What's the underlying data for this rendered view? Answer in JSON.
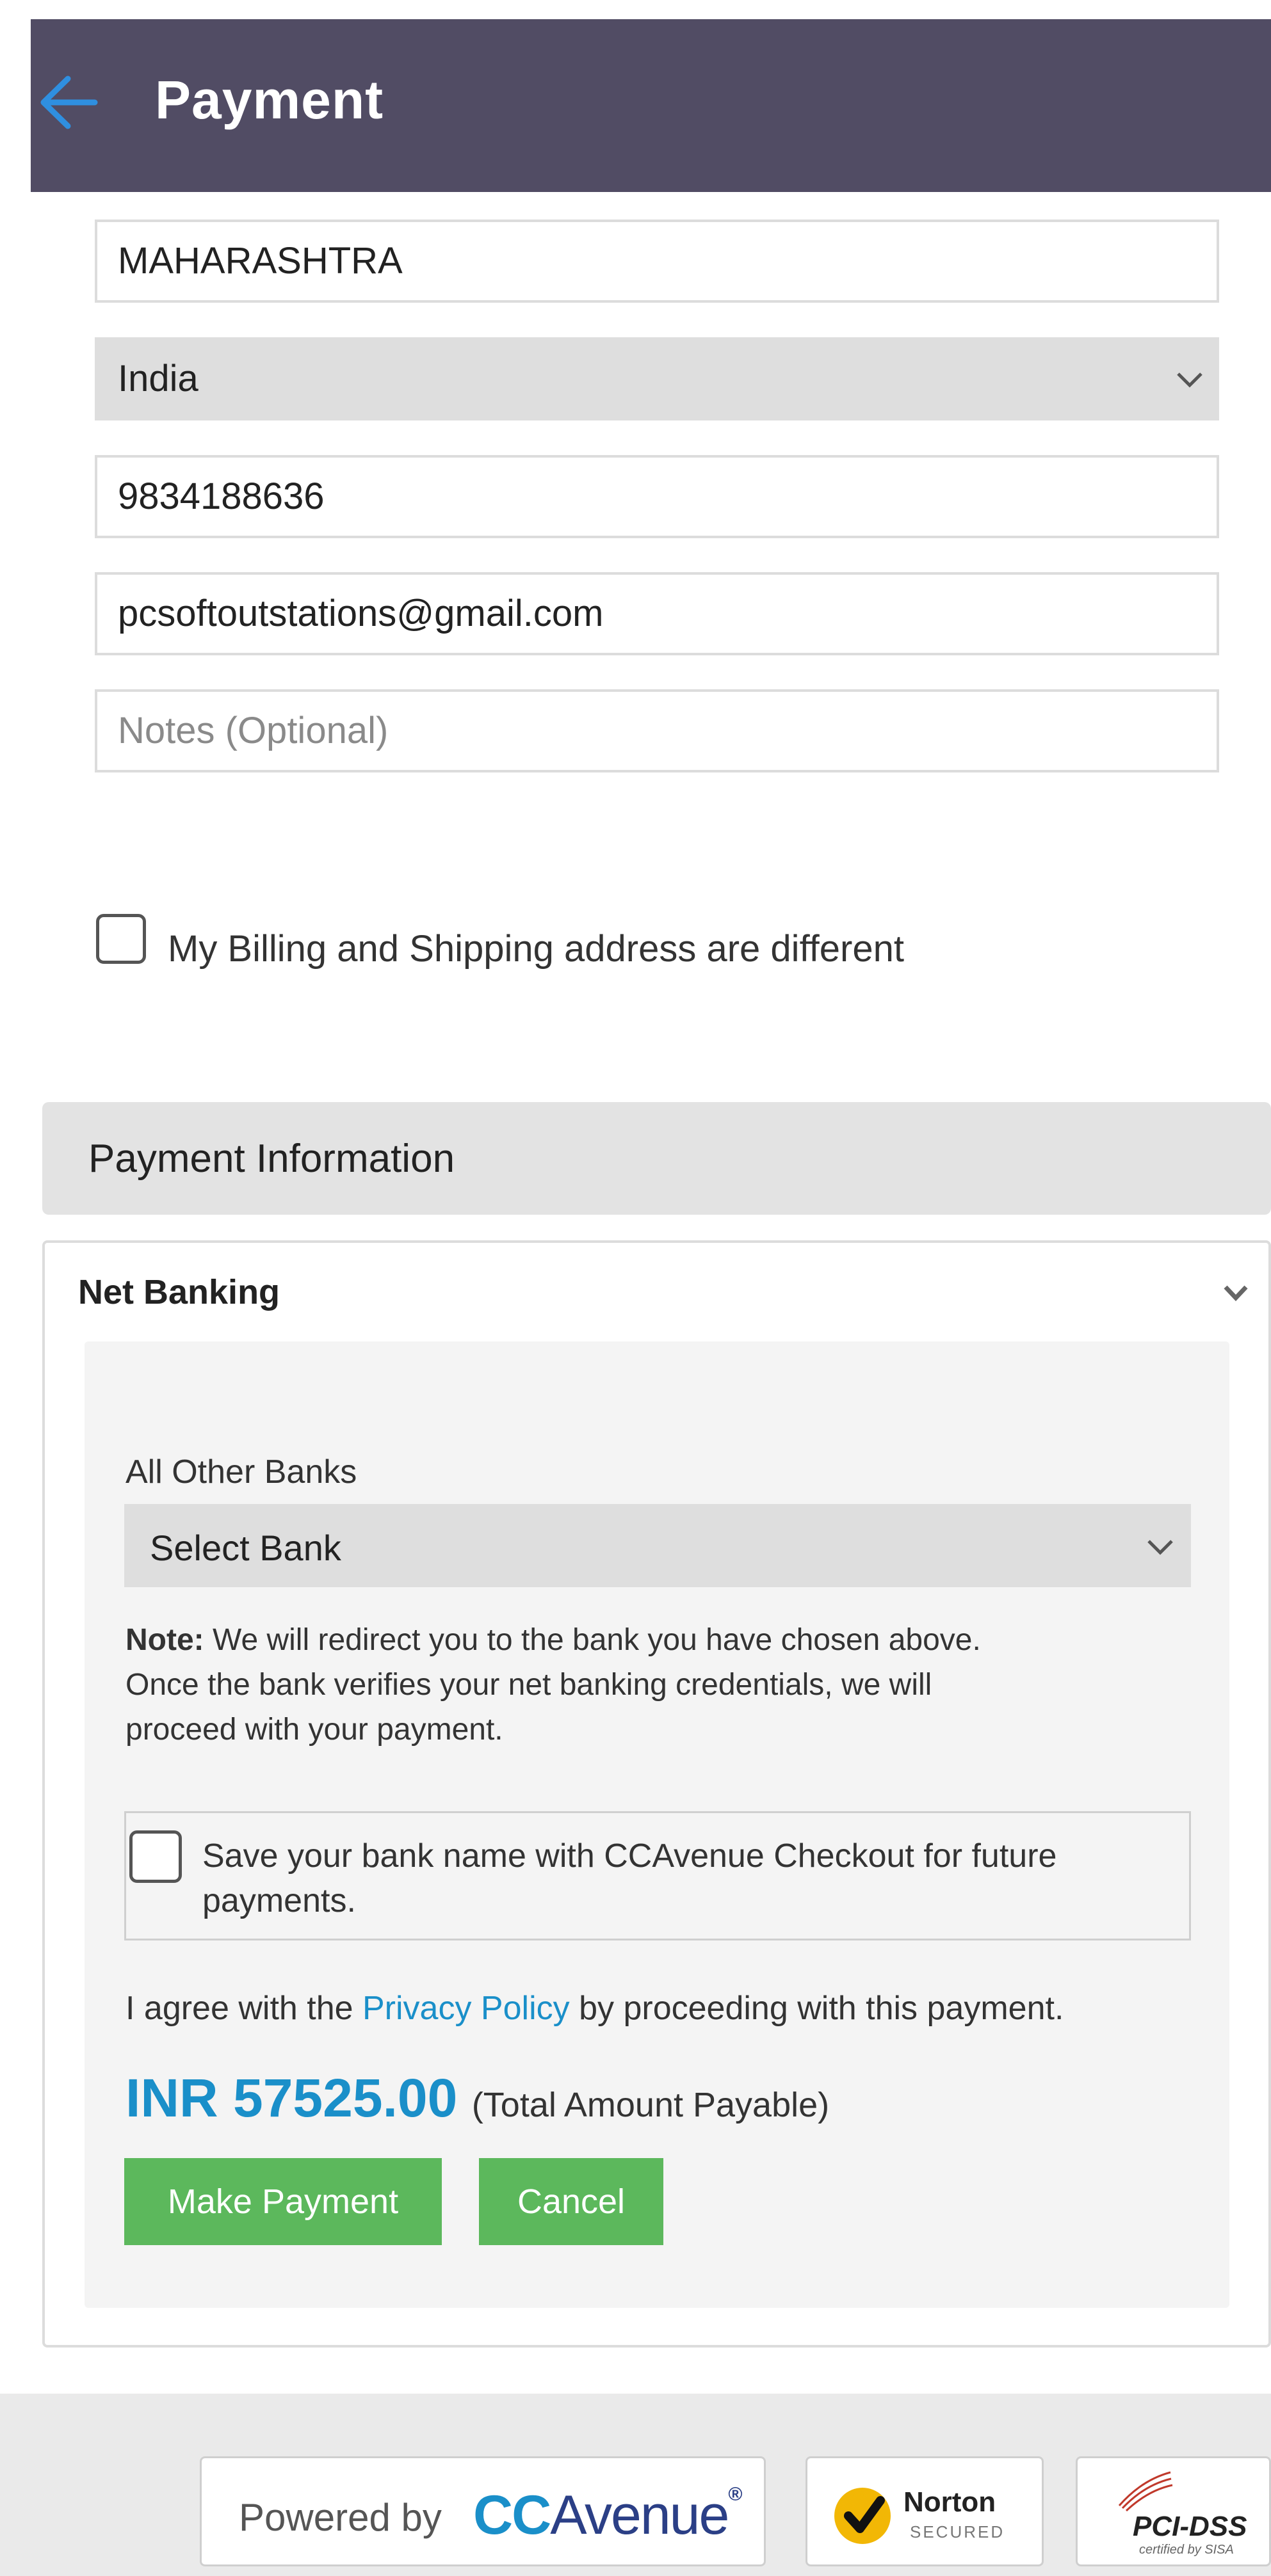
{
  "header": {
    "title": "Payment",
    "back_icon": "back-arrow-icon"
  },
  "form": {
    "state": "MAHARASHTRA",
    "country": "India",
    "phone": "9834188636",
    "email": "pcsoftoutstations@gmail.com",
    "notes_placeholder": "Notes (Optional)",
    "different_address_label": "My Billing and Shipping address are different"
  },
  "payment": {
    "section_title": "Payment Information",
    "method": "Net Banking",
    "bank_group_label": "All Other Banks",
    "bank_select_value": "Select Bank",
    "note_label": "Note:",
    "note_line1": "We will redirect you to the bank you have chosen above.",
    "note_line2": "Once the bank verifies your net banking credentials, we will",
    "note_line3": "proceed with your payment.",
    "save_bank_line1": "Save your bank name with CCAvenue Checkout for future",
    "save_bank_line2": "payments.",
    "agree_prefix": "I agree with the",
    "privacy_link": "Privacy Policy",
    "agree_suffix": "by proceeding with this payment.",
    "amount": "INR 57525.00",
    "amount_note": "(Total Amount Payable)",
    "make_payment": "Make Payment",
    "cancel": "Cancel"
  },
  "footer": {
    "powered_by": "Powered by",
    "brand_cc": "CC",
    "brand_avenue": "Avenue",
    "brand_mark": "®",
    "norton": "Norton",
    "norton_sub": "SECURED",
    "pci": "PCI-DSS",
    "pci_sub": "certified by SISA"
  },
  "colors": {
    "header_bg": "#514c64",
    "accent_blue": "#1a8fc9",
    "button_green": "#5cb85c",
    "norton_yellow": "#f2b705",
    "pci_red": "#c0392b"
  }
}
